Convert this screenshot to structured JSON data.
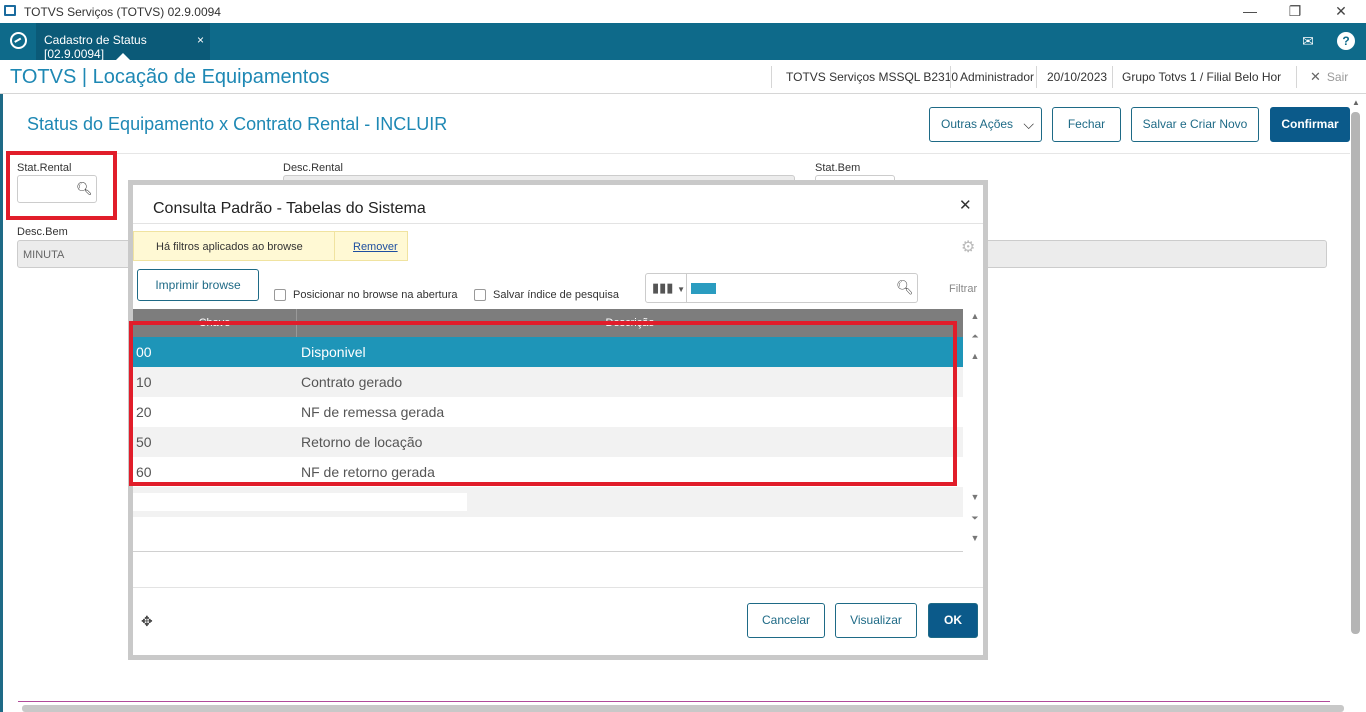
{
  "window": {
    "title": "TOTVS Serviços (TOTVS) 02.9.0094",
    "minimize": "—",
    "restore": "❐",
    "close": "✕"
  },
  "tab": {
    "label": "Cadastro de Status [02.9.0094]",
    "close": "×"
  },
  "header": {
    "brand": "TOTVS | Locação de Equipamentos",
    "env": "TOTVS Serviços MSSQL B2310",
    "user": "Administrador",
    "date": "20/10/2023",
    "branch": "Grupo Totvs 1 / Filial Belo Hor",
    "exit": "Sair"
  },
  "page": {
    "title": "Status do Equipamento x Contrato Rental - INCLUIR",
    "buttons": {
      "other": "Outras Ações",
      "close": "Fechar",
      "save_new": "Salvar e Criar Novo",
      "confirm": "Confirmar"
    }
  },
  "form": {
    "stat_rental_label": "Stat.Rental",
    "desc_rental_label": "Desc.Rental",
    "stat_bem_label": "Stat.Bem",
    "desc_bem_label": "Desc.Bem",
    "desc_bem_value": "MINUTA"
  },
  "modal": {
    "title": "Consulta Padrão - Tabelas do Sistema",
    "filter_notice": "Há filtros aplicados ao browse",
    "filter_remove": "Remover",
    "print_button": "Imprimir browse",
    "check_position": "Posicionar no browse na abertura",
    "check_save_index": "Salvar índice de pesquisa",
    "filter_label": "Filtrar",
    "columns": [
      "Chave",
      "Descrição"
    ],
    "rows": [
      {
        "key": "00",
        "desc": "Disponivel"
      },
      {
        "key": "10",
        "desc": "Contrato gerado"
      },
      {
        "key": "20",
        "desc": "NF de remessa gerada"
      },
      {
        "key": "50",
        "desc": "Retorno de locação"
      },
      {
        "key": "60",
        "desc": "NF de retorno gerada"
      }
    ],
    "buttons": {
      "cancel": "Cancelar",
      "view": "Visualizar",
      "ok": "OK"
    }
  },
  "colors": {
    "accent": "#1e88b4",
    "primary": "#0b5a8a",
    "highlight": "#e11d2a",
    "selected_row": "#1e95b8"
  },
  "icons": [
    "app-icon",
    "totvs-logo-icon",
    "mail-icon",
    "help-icon",
    "search-icon",
    "gear-icon",
    "columns-icon",
    "move-icon"
  ]
}
